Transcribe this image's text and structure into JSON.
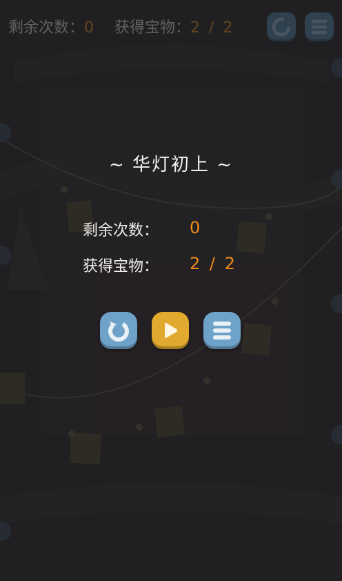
{
  "hud": {
    "remaining_label": "剩余次数：",
    "remaining_value": "0",
    "treasure_label": "获得宝物：",
    "treasure_value": "2 / 2"
  },
  "panel": {
    "title": "~ 华灯初上 ~",
    "remaining_label": "剩余次数：",
    "remaining_value": "0",
    "treasure_label": "获得宝物：",
    "treasure_value": "2 / 2"
  },
  "buttons": [
    {
      "icon": "restart-icon",
      "color": "#6fa2c9"
    },
    {
      "icon": "play-icon",
      "color": "#e2a92f"
    },
    {
      "icon": "menu-icon",
      "color": "#6fa2c9"
    }
  ],
  "colors": {
    "accent": "#f08a1c",
    "text": "#f1efe9",
    "background": "#2b2b2d"
  }
}
